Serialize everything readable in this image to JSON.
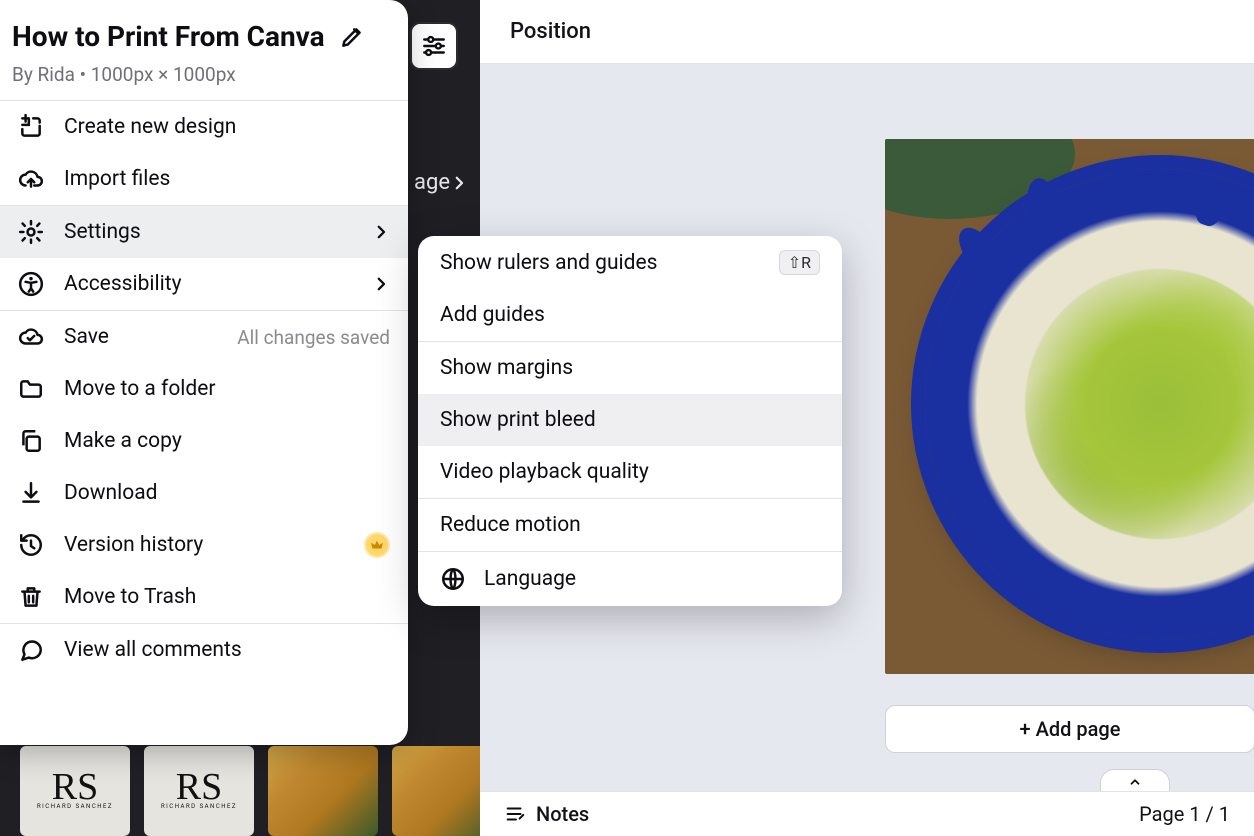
{
  "doc": {
    "title": "How to Print From Canva",
    "meta": "By Rida • 1000px × 1000px"
  },
  "menu": {
    "create": "Create new design",
    "import": "Import files",
    "settings": "Settings",
    "accessibility": "Accessibility",
    "save": "Save",
    "save_hint": "All changes saved",
    "move_folder": "Move to a folder",
    "make_copy": "Make a copy",
    "download": "Download",
    "version_history": "Version history",
    "move_trash": "Move to Trash",
    "view_comments": "View all comments"
  },
  "submenu": {
    "rulers": "Show rulers and guides",
    "rulers_shortcut": "⇧R",
    "add_guides": "Add guides",
    "show_margins": "Show margins",
    "show_bleed": "Show print bleed",
    "video_quality": "Video playback quality",
    "reduce_motion": "Reduce motion",
    "language": "Language"
  },
  "toolbar": {
    "position": "Position"
  },
  "canvas": {
    "page_chip": "age",
    "add_page": "+ Add page"
  },
  "bottom": {
    "notes": "Notes",
    "page_counter": "Page 1 / 1"
  },
  "thumbs": {
    "rs_mono": "RS",
    "rs_name": "RICHARD SANCHEZ"
  }
}
